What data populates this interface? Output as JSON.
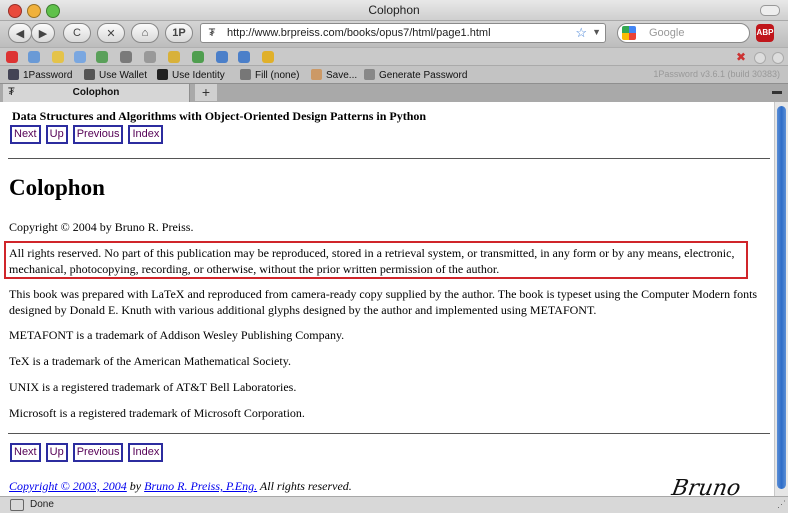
{
  "window": {
    "title": "Colophon"
  },
  "navbar": {
    "back": "◀",
    "forward": "▶",
    "reload": "C",
    "stop": "✕",
    "home": "⌂",
    "onepassword": "1P",
    "url": "http://www.brpreiss.com/books/opus7/html/page1.html",
    "search_placeholder": "Google",
    "adblock": "ABP"
  },
  "password_bar": {
    "items": [
      "1Password",
      "Use Wallet",
      "Use Identity",
      "Fill (none)",
      "Save...",
      "Generate Password"
    ],
    "build": "1Password v3.6.1 (build 30383)"
  },
  "tabs": [
    {
      "label": "Colophon"
    }
  ],
  "page": {
    "book_title": "Data Structures and Algorithms with Object-Oriented Design Patterns in Python",
    "nav_buttons": [
      "Next",
      "Up",
      "Previous",
      "Index"
    ],
    "heading": "Colophon",
    "copyright": "Copyright © 2004 by Bruno R. Preiss.",
    "rights": "All rights reserved. No part of this publication may be reproduced, stored in a retrieval system, or transmitted, in any form or by any means, electronic, mechanical, photocopying, recording, or otherwise, without the prior written permission of the author.",
    "prepared": "This book was prepared with LaTeX and reproduced from camera-ready copy supplied by the author. The book is typeset using the Computer Modern fonts designed by Donald E. Knuth with various additional glyphs designed by the author and implemented using METAFONT.",
    "metafont": "METAFONT is a trademark of Addison Wesley Publishing Company.",
    "tex": "TeX is a trademark of the American Mathematical Society.",
    "unix": "UNIX is a registered trademark of AT&T Bell Laboratories.",
    "microsoft": "Microsoft is a registered trademark of Microsoft Corporation.",
    "footer_link1": "Copyright © 2003, 2004",
    "footer_by": " by ",
    "footer_link2": "Bruno R. Preiss, P.Eng.",
    "footer_tail": " All rights reserved.",
    "signature": "Bruno"
  },
  "status": {
    "text": "Done"
  },
  "colors": {
    "highlight_border": "#d0252a",
    "nav_border": "#2c2c9f",
    "nav_text": "#550055"
  }
}
